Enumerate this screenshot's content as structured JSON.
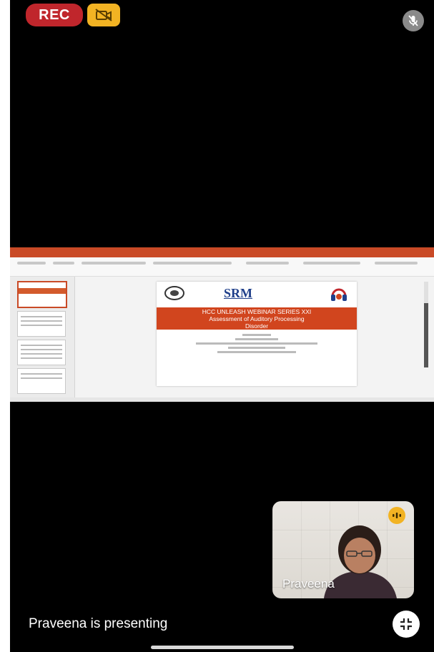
{
  "top_bar": {
    "rec_label": "REC",
    "camera_icon": "video-off-icon",
    "mic_icon": "mic-off-icon"
  },
  "shared_screen": {
    "slide": {
      "logo_text": "SRM",
      "band_line1": "HCC UNLEASH WEBINAR SERIES XXI",
      "band_line2": "Assessment of Auditory Processing",
      "band_line3": "Disorder"
    }
  },
  "participant_tile": {
    "name": "Praveena",
    "speaking_icon": "audio-wave-icon"
  },
  "footer": {
    "presenting_text": "Praveena is presenting",
    "exit_icon": "exit-fullscreen-icon"
  },
  "colors": {
    "rec": "#c0262c",
    "camera_badge": "#f2b323",
    "ppt_orange": "#d1451e"
  }
}
